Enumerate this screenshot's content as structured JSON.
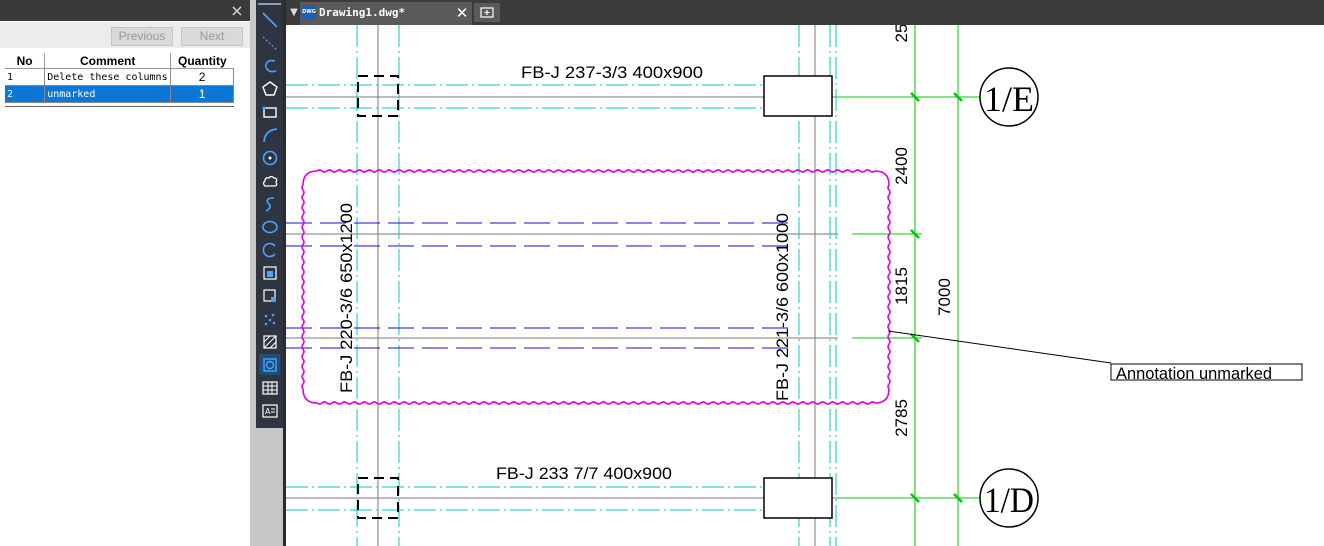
{
  "panel": {
    "close_glyph": "×",
    "previous_label": "Previous",
    "next_label": "Next",
    "columns": [
      "No",
      "Comment",
      "Quantity"
    ],
    "rows": [
      {
        "no": "1",
        "comment": "Delete these columns",
        "quantity": "2"
      },
      {
        "no": "2",
        "comment": "unmarked",
        "quantity": "1"
      }
    ]
  },
  "tabs": {
    "dropdown_glyph": "▼",
    "icon_text": "DWG",
    "drawing_tab": "Drawing1.dwg*",
    "close_glyph": "✕"
  },
  "toolbar": {
    "tools": [
      "line-tool-icon",
      "construction-line-icon",
      "polyline-icon",
      "polygon-icon",
      "rectangle-icon",
      "arc-icon",
      "circle-icon",
      "revision-cloud-icon",
      "spline-icon",
      "ellipse-icon",
      "ellipse-arc-icon",
      "insert-block-icon",
      "make-block-icon",
      "point-icon",
      "hatch-icon",
      "region-icon",
      "table-icon",
      "multiline-text-icon"
    ],
    "active_tool": "region-icon"
  },
  "drawing": {
    "beam_top": "FB-J 237-3/3 400x900",
    "beam_bottom": "FB-J 233 7/7 400x900",
    "beam_left_vertical": "FB-J 220-3/6 650x1200",
    "beam_right_vertical": "FB-J 221-3/6 600x1000",
    "dim_25": "25",
    "dim_2400": "2400",
    "dim_1815": "1815",
    "dim_2785": "2785",
    "dim_7000": "7000",
    "axis_top": "1/E",
    "axis_bottom": "1/D",
    "annotation": "Annotation unmarked",
    "colors": {
      "cyan": "#00c8c8",
      "blue": "#1010d8",
      "green": "#00c800",
      "magenta": "#e000e0",
      "grey": "#7a7a7a"
    }
  }
}
